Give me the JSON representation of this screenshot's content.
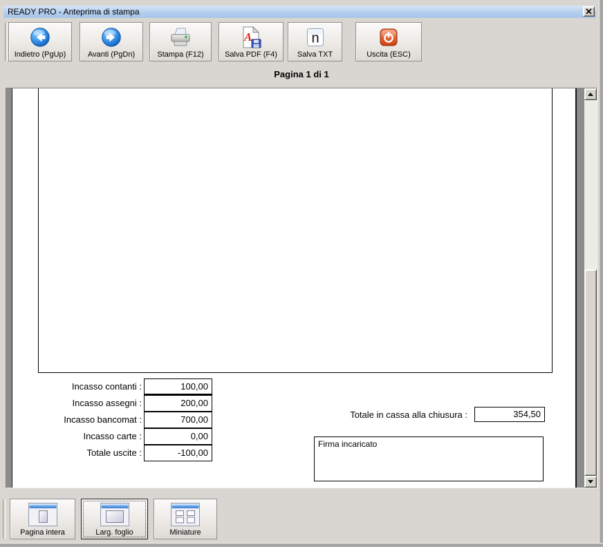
{
  "window": {
    "title": "READY PRO - Anteprima di stampa"
  },
  "toolbar": {
    "buttons": [
      {
        "label": "Indietro (PgUp)",
        "icon": "arrow-left-circle"
      },
      {
        "label": "Avanti (PgDn)",
        "icon": "arrow-right-circle"
      },
      {
        "label": "Stampa (F12)",
        "icon": "printer"
      },
      {
        "label": "Salva PDF (F4)",
        "icon": "pdf-page-floppy"
      },
      {
        "label": "Salva TXT",
        "icon": "notepad-n"
      },
      {
        "label": "Uscita (ESC)",
        "icon": "power-red"
      }
    ]
  },
  "page_indicator": "Pagina 1 di 1",
  "preview": {
    "fields": [
      {
        "label": "Incasso contanti :",
        "value": "100,00"
      },
      {
        "label": "Incasso assegni :",
        "value": "200,00"
      },
      {
        "label": "Incasso bancomat :",
        "value": "700,00"
      },
      {
        "label": "Incasso carte :",
        "value": "0,00"
      },
      {
        "label": "Totale uscite :",
        "value": "-100,00"
      }
    ],
    "closing_total": {
      "label": "Totale in cassa alla chiusura :",
      "value": "354,50"
    },
    "signature_box_label": "Firma incaricato"
  },
  "zoom_toolbar": {
    "buttons": [
      {
        "label": "Pagina intera",
        "icon": "window-full-page",
        "selected": false
      },
      {
        "label": "Larg. foglio",
        "icon": "window-page-width",
        "selected": true
      },
      {
        "label": "Miniature",
        "icon": "window-thumbnails",
        "selected": false
      }
    ]
  },
  "icons": {
    "save_txt_glyph": "n",
    "close": "x"
  },
  "colors": {
    "titlebar_blue": "#b4cfee",
    "window_bg": "#d9d6d1",
    "nav_icon_blue": "#1e6ed0",
    "exit_red": "#d6481c",
    "page_bg": "#ffffff",
    "border_black": "#000000"
  }
}
